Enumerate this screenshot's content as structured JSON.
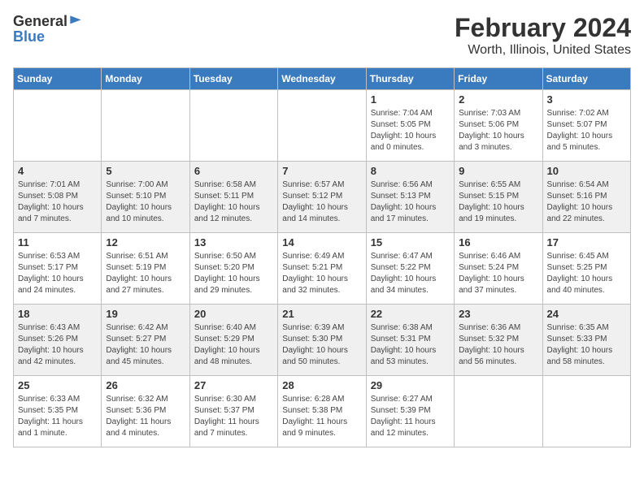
{
  "header": {
    "logo_general": "General",
    "logo_blue": "Blue",
    "month_title": "February 2024",
    "location": "Worth, Illinois, United States"
  },
  "days_of_week": [
    "Sunday",
    "Monday",
    "Tuesday",
    "Wednesday",
    "Thursday",
    "Friday",
    "Saturday"
  ],
  "weeks": [
    [
      {
        "day": "",
        "info": ""
      },
      {
        "day": "",
        "info": ""
      },
      {
        "day": "",
        "info": ""
      },
      {
        "day": "",
        "info": ""
      },
      {
        "day": "1",
        "info": "Sunrise: 7:04 AM\nSunset: 5:05 PM\nDaylight: 10 hours\nand 0 minutes."
      },
      {
        "day": "2",
        "info": "Sunrise: 7:03 AM\nSunset: 5:06 PM\nDaylight: 10 hours\nand 3 minutes."
      },
      {
        "day": "3",
        "info": "Sunrise: 7:02 AM\nSunset: 5:07 PM\nDaylight: 10 hours\nand 5 minutes."
      }
    ],
    [
      {
        "day": "4",
        "info": "Sunrise: 7:01 AM\nSunset: 5:08 PM\nDaylight: 10 hours\nand 7 minutes."
      },
      {
        "day": "5",
        "info": "Sunrise: 7:00 AM\nSunset: 5:10 PM\nDaylight: 10 hours\nand 10 minutes."
      },
      {
        "day": "6",
        "info": "Sunrise: 6:58 AM\nSunset: 5:11 PM\nDaylight: 10 hours\nand 12 minutes."
      },
      {
        "day": "7",
        "info": "Sunrise: 6:57 AM\nSunset: 5:12 PM\nDaylight: 10 hours\nand 14 minutes."
      },
      {
        "day": "8",
        "info": "Sunrise: 6:56 AM\nSunset: 5:13 PM\nDaylight: 10 hours\nand 17 minutes."
      },
      {
        "day": "9",
        "info": "Sunrise: 6:55 AM\nSunset: 5:15 PM\nDaylight: 10 hours\nand 19 minutes."
      },
      {
        "day": "10",
        "info": "Sunrise: 6:54 AM\nSunset: 5:16 PM\nDaylight: 10 hours\nand 22 minutes."
      }
    ],
    [
      {
        "day": "11",
        "info": "Sunrise: 6:53 AM\nSunset: 5:17 PM\nDaylight: 10 hours\nand 24 minutes."
      },
      {
        "day": "12",
        "info": "Sunrise: 6:51 AM\nSunset: 5:19 PM\nDaylight: 10 hours\nand 27 minutes."
      },
      {
        "day": "13",
        "info": "Sunrise: 6:50 AM\nSunset: 5:20 PM\nDaylight: 10 hours\nand 29 minutes."
      },
      {
        "day": "14",
        "info": "Sunrise: 6:49 AM\nSunset: 5:21 PM\nDaylight: 10 hours\nand 32 minutes."
      },
      {
        "day": "15",
        "info": "Sunrise: 6:47 AM\nSunset: 5:22 PM\nDaylight: 10 hours\nand 34 minutes."
      },
      {
        "day": "16",
        "info": "Sunrise: 6:46 AM\nSunset: 5:24 PM\nDaylight: 10 hours\nand 37 minutes."
      },
      {
        "day": "17",
        "info": "Sunrise: 6:45 AM\nSunset: 5:25 PM\nDaylight: 10 hours\nand 40 minutes."
      }
    ],
    [
      {
        "day": "18",
        "info": "Sunrise: 6:43 AM\nSunset: 5:26 PM\nDaylight: 10 hours\nand 42 minutes."
      },
      {
        "day": "19",
        "info": "Sunrise: 6:42 AM\nSunset: 5:27 PM\nDaylight: 10 hours\nand 45 minutes."
      },
      {
        "day": "20",
        "info": "Sunrise: 6:40 AM\nSunset: 5:29 PM\nDaylight: 10 hours\nand 48 minutes."
      },
      {
        "day": "21",
        "info": "Sunrise: 6:39 AM\nSunset: 5:30 PM\nDaylight: 10 hours\nand 50 minutes."
      },
      {
        "day": "22",
        "info": "Sunrise: 6:38 AM\nSunset: 5:31 PM\nDaylight: 10 hours\nand 53 minutes."
      },
      {
        "day": "23",
        "info": "Sunrise: 6:36 AM\nSunset: 5:32 PM\nDaylight: 10 hours\nand 56 minutes."
      },
      {
        "day": "24",
        "info": "Sunrise: 6:35 AM\nSunset: 5:33 PM\nDaylight: 10 hours\nand 58 minutes."
      }
    ],
    [
      {
        "day": "25",
        "info": "Sunrise: 6:33 AM\nSunset: 5:35 PM\nDaylight: 11 hours\nand 1 minute."
      },
      {
        "day": "26",
        "info": "Sunrise: 6:32 AM\nSunset: 5:36 PM\nDaylight: 11 hours\nand 4 minutes."
      },
      {
        "day": "27",
        "info": "Sunrise: 6:30 AM\nSunset: 5:37 PM\nDaylight: 11 hours\nand 7 minutes."
      },
      {
        "day": "28",
        "info": "Sunrise: 6:28 AM\nSunset: 5:38 PM\nDaylight: 11 hours\nand 9 minutes."
      },
      {
        "day": "29",
        "info": "Sunrise: 6:27 AM\nSunset: 5:39 PM\nDaylight: 11 hours\nand 12 minutes."
      },
      {
        "day": "",
        "info": ""
      },
      {
        "day": "",
        "info": ""
      }
    ]
  ]
}
